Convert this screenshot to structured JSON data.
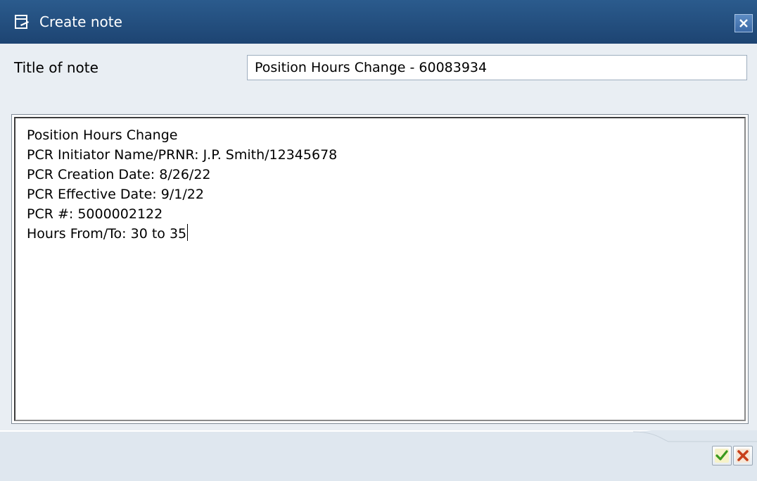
{
  "window": {
    "title": "Create note",
    "icon": "edit-document-icon",
    "close_icon": "close-icon"
  },
  "form": {
    "title_label": "Title of note",
    "title_value": "Position Hours Change - 60083934"
  },
  "note": {
    "lines": [
      "Position Hours Change",
      "PCR Initiator Name/PRNR: J.P. Smith/12345678",
      "PCR Creation Date: 8/26/22",
      "PCR Effective Date: 9/1/22",
      "PCR #: 5000002122",
      "Hours From/To: 30 to 35"
    ]
  },
  "actions": {
    "confirm_icon": "checkmark-icon",
    "cancel_icon": "cancel-x-icon"
  },
  "colors": {
    "titlebar": "#1d4472",
    "confirm": "#3a9a1e",
    "cancel": "#c8401a"
  }
}
